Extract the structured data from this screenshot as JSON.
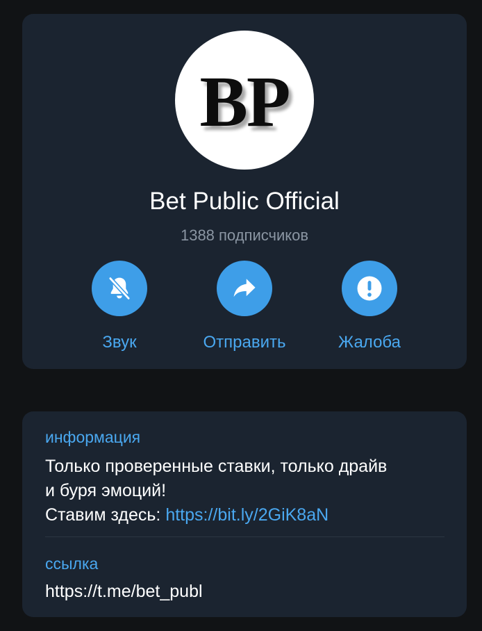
{
  "profile": {
    "avatar_text": "BP",
    "name": "Bet Public Official",
    "subscribers": "1388 подписчиков"
  },
  "actions": [
    {
      "label": "Звук",
      "icon": "bell-muted-icon"
    },
    {
      "label": "Отправить",
      "icon": "share-arrow-icon"
    },
    {
      "label": "Жалоба",
      "icon": "exclamation-icon"
    }
  ],
  "info": {
    "label": "информация",
    "description_line1": "Только проверенные ставки, только драйв",
    "description_line2": "и буря эмоций!",
    "description_line3_prefix": "Ставим здесь: ",
    "description_link": "https://bit.ly/2GiK8aN"
  },
  "link": {
    "label": "ссылка",
    "value": "https://t.me/bet_publ"
  },
  "colors": {
    "background": "#111315",
    "card": "#1b2430",
    "accent": "#3e9ee8",
    "link": "#4aa8f0"
  }
}
